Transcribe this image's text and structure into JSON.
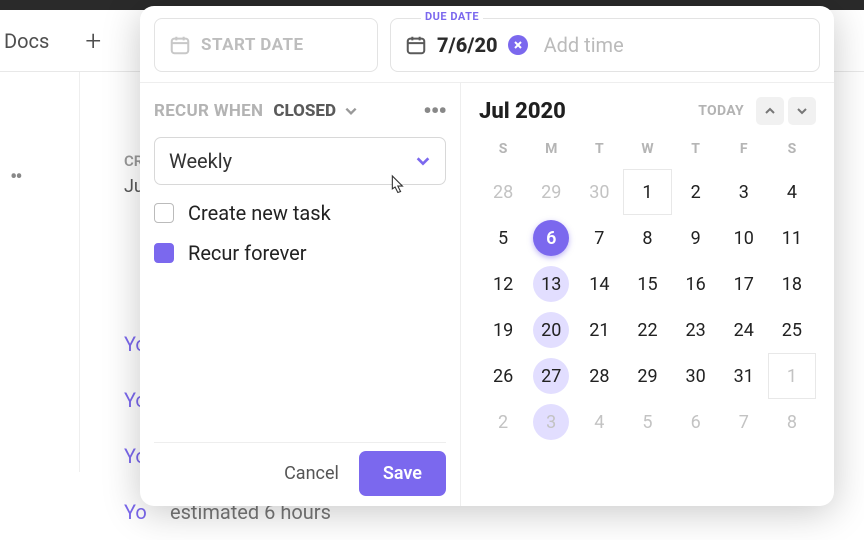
{
  "bg": {
    "docs": "Docs",
    "plus": "+",
    "cr": "CR",
    "ju": "Ju",
    "you": "Yo",
    "est": "estimated 6 hours"
  },
  "header": {
    "start_placeholder": "START DATE",
    "due_label": "DUE DATE",
    "due_value": "7/6/20",
    "add_time": "Add time"
  },
  "recur": {
    "label": "RECUR WHEN",
    "status": "CLOSED",
    "freq": "Weekly",
    "opt_create": "Create new task",
    "opt_forever": "Recur forever"
  },
  "footer": {
    "cancel": "Cancel",
    "save": "Save"
  },
  "calendar": {
    "month": "Jul 2020",
    "today": "TODAY",
    "dow": [
      "S",
      "M",
      "T",
      "W",
      "T",
      "F",
      "S"
    ],
    "weeks": [
      [
        {
          "d": 28,
          "out": true
        },
        {
          "d": 29,
          "out": true
        },
        {
          "d": 30,
          "out": true
        },
        {
          "d": 1,
          "box": true
        },
        {
          "d": 2
        },
        {
          "d": 3
        },
        {
          "d": 4
        }
      ],
      [
        {
          "d": 5
        },
        {
          "d": 6,
          "sel": true
        },
        {
          "d": 7
        },
        {
          "d": 8
        },
        {
          "d": 9
        },
        {
          "d": 10
        },
        {
          "d": 11
        }
      ],
      [
        {
          "d": 12
        },
        {
          "d": 13,
          "hl": true
        },
        {
          "d": 14
        },
        {
          "d": 15
        },
        {
          "d": 16
        },
        {
          "d": 17
        },
        {
          "d": 18
        }
      ],
      [
        {
          "d": 19
        },
        {
          "d": 20,
          "hl": true
        },
        {
          "d": 21
        },
        {
          "d": 22
        },
        {
          "d": 23
        },
        {
          "d": 24
        },
        {
          "d": 25
        }
      ],
      [
        {
          "d": 26
        },
        {
          "d": 27,
          "hl": true
        },
        {
          "d": 28
        },
        {
          "d": 29
        },
        {
          "d": 30
        },
        {
          "d": 31
        },
        {
          "d": 1,
          "out": true,
          "box": true
        }
      ],
      [
        {
          "d": 2,
          "out": true
        },
        {
          "d": 3,
          "out": true,
          "hl": true
        },
        {
          "d": 4,
          "out": true
        },
        {
          "d": 5,
          "out": true
        },
        {
          "d": 6,
          "out": true
        },
        {
          "d": 7,
          "out": true
        },
        {
          "d": 8,
          "out": true
        }
      ]
    ]
  }
}
